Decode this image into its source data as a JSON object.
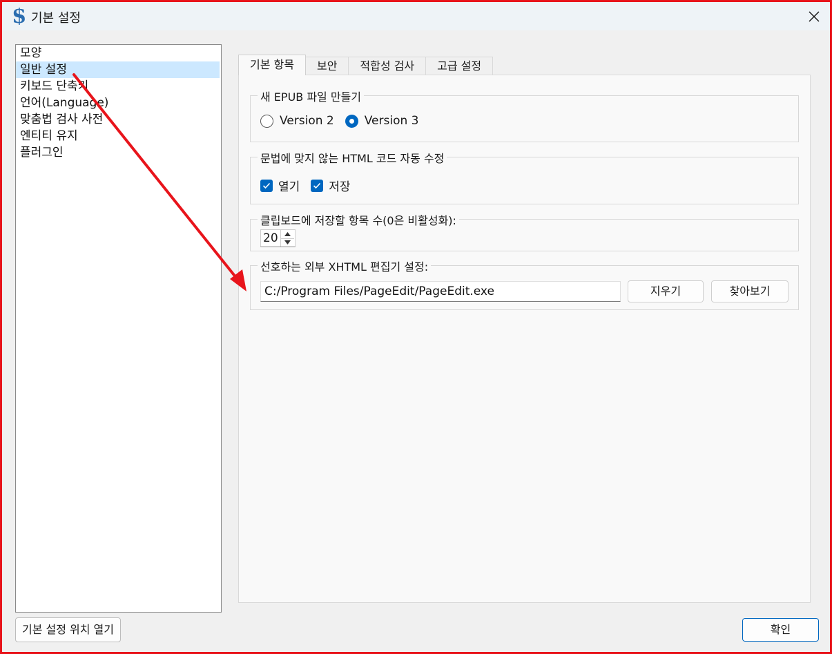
{
  "window": {
    "title": "기본 설정",
    "close_label": "×"
  },
  "sidebar": {
    "items": [
      {
        "label": "모양"
      },
      {
        "label": "일반 설정",
        "selected": true
      },
      {
        "label": "키보드 단축키"
      },
      {
        "label": "언어(Language)"
      },
      {
        "label": "맞춤법 검사 사전"
      },
      {
        "label": "엔티티 유지"
      },
      {
        "label": "플러그인"
      }
    ]
  },
  "tabs": [
    {
      "label": "기본 항목",
      "active": true
    },
    {
      "label": "보안"
    },
    {
      "label": "적합성 검사"
    },
    {
      "label": "고급 설정"
    }
  ],
  "groups": {
    "epub": {
      "legend": "새 EPUB 파일 만들기",
      "options": [
        {
          "label": "Version 2",
          "checked": false
        },
        {
          "label": "Version 3",
          "checked": true
        }
      ]
    },
    "html_fix": {
      "legend": "문법에 맞지 않는 HTML 코드 자동 수정",
      "options": [
        {
          "label": "열기",
          "checked": true
        },
        {
          "label": "저장",
          "checked": true
        }
      ]
    },
    "clipboard": {
      "legend": "클립보드에 저장할 항목 수(0은 비활성화):",
      "value": "20"
    },
    "editor": {
      "legend": "선호하는 외부 XHTML 편집기 설정:",
      "path": "C:/Program Files/PageEdit/PageEdit.exe",
      "clear_label": "지우기",
      "browse_label": "찾아보기"
    }
  },
  "footer": {
    "open_location_label": "기본 설정 위치 열기",
    "ok_label": "확인"
  },
  "colors": {
    "accent": "#0067c0",
    "annotation": "#e8141b",
    "selection": "#cce8ff"
  }
}
